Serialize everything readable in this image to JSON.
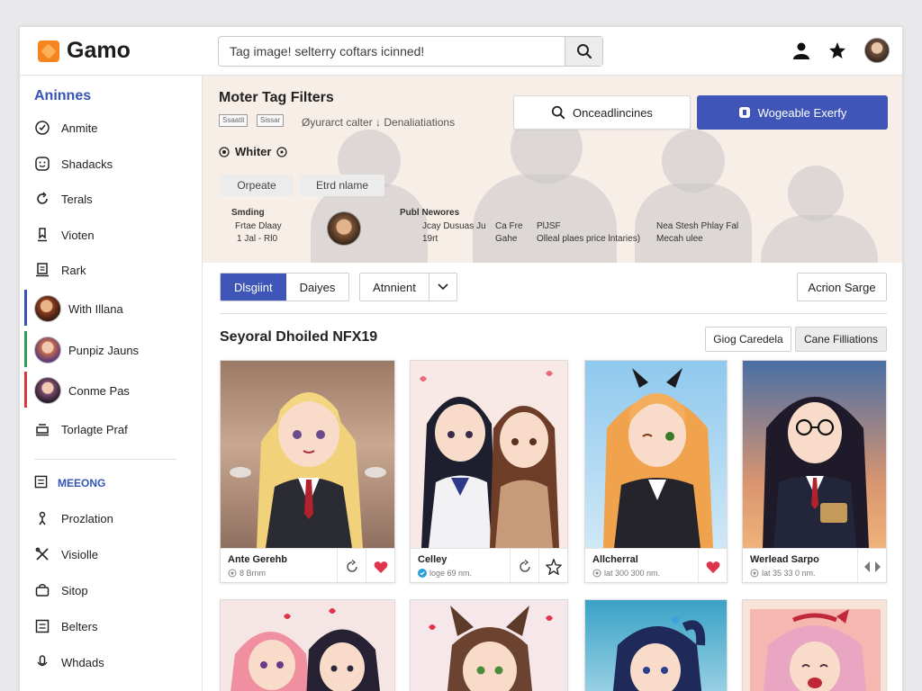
{
  "app": {
    "logo_text": "Gamo"
  },
  "search": {
    "placeholder": "Tag image! selterry coftars icinned!"
  },
  "sidebar": {
    "heading": "Aninnes",
    "items": [
      {
        "label": "Anmite",
        "icon": "check-circle-icon"
      },
      {
        "label": "Shadacks",
        "icon": "smiley-icon"
      },
      {
        "label": "Terals",
        "icon": "refresh-icon"
      },
      {
        "label": "Vioten",
        "icon": "bookmark-icon"
      },
      {
        "label": "Rark",
        "icon": "document-icon"
      }
    ],
    "avatars": [
      {
        "label": "With Illana",
        "bar_color": "#3654b6"
      },
      {
        "label": "Punpiz Jauns",
        "bar_color": "#2e9e4e"
      },
      {
        "label": "Conme Pas",
        "bar_color": "#d63a3a"
      }
    ],
    "extra_item": {
      "label": "Torlagte Praf",
      "icon": "print-icon"
    },
    "section_label": "MEEONG",
    "section_items": [
      {
        "label": "Prozlation",
        "icon": "person-icon"
      },
      {
        "label": "Visiolle",
        "icon": "tools-icon"
      },
      {
        "label": "Sitop",
        "icon": "bag-icon"
      },
      {
        "label": "Belters",
        "icon": "list-icon"
      },
      {
        "label": "Whdads",
        "icon": "microphone-icon"
      }
    ]
  },
  "hero": {
    "title": "Moter Tag Filters",
    "chips": [
      "Ssaatit",
      "Sissar"
    ],
    "subtitle": "Øyurarct calter ↓ Denaliatiations",
    "whiter_label": "Whiter",
    "pills": [
      "Orpeate",
      "Etrd nlame"
    ],
    "sending_label": "Smding",
    "sending_lines": [
      "Frtae Dlaay",
      "1 Jal - Rl0"
    ],
    "publ_label": "Publ Newores",
    "stats": [
      {
        "line1": "Jcay Dusuas Ju",
        "line2": "19rt"
      },
      {
        "line1": "Ca Fre",
        "line2": "Gahe"
      },
      {
        "line1": "PlJSF",
        "line2": "Olleal plaes price lntaries)"
      }
    ],
    "right_lines": [
      "Nea Stesh Phlay Fal",
      "Mecah ulee"
    ],
    "btn_search_label": "Onceadlincines",
    "btn_primary_label": "Wogeable Exerfy"
  },
  "controls": {
    "seg_on": "Dlsgiint",
    "seg_off": "Daiyes",
    "dropdown_label": "Atnnient",
    "action_label": "Acrion Sarge"
  },
  "section": {
    "title": "Seyoral Dhoiled NFX19",
    "btn1": "Giog Caredela",
    "btn2": "Cane Filliations"
  },
  "cards": [
    {
      "name": "Ante Gerehb",
      "sub": "8 Brnm",
      "act2": "heart-icon"
    },
    {
      "name": "Celley",
      "sub": "loge 69 nm.",
      "act2": "star-icon"
    },
    {
      "name": "Allcherral",
      "sub": "lat 300 300 nm.",
      "act2": "heart-icon"
    },
    {
      "name": "Werlead Sarpo",
      "sub": "lat 35 33 0 nm.",
      "act2": "diamond-icon"
    }
  ],
  "colors": {
    "accent": "#3f56b8",
    "logo": "#f6851f",
    "heart": "#e0344a"
  }
}
